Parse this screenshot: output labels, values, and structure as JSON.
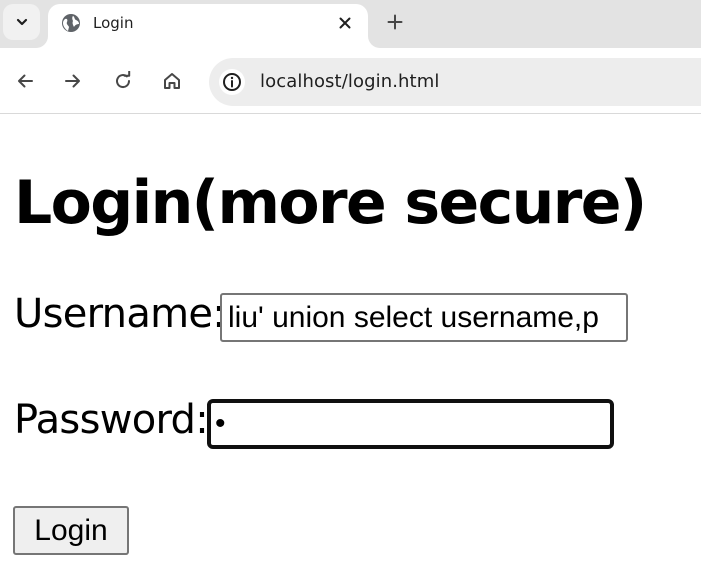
{
  "browser": {
    "tab": {
      "title": "Login",
      "favicon_icon": "globe-icon",
      "close_icon": "close-icon"
    },
    "tab_menu_icon": "chevron-down-icon",
    "new_tab_icon": "plus-icon",
    "nav": {
      "back_icon": "arrow-left-icon",
      "forward_icon": "arrow-right-icon",
      "reload_icon": "reload-icon",
      "home_icon": "home-icon"
    },
    "address_bar": {
      "info_icon": "info-icon",
      "url": "localhost/login.html"
    }
  },
  "page": {
    "title": "Login(more secure)",
    "username": {
      "label": "Username:",
      "value": "liu' union select username,p"
    },
    "password": {
      "label": "Password:",
      "value": "•"
    },
    "login_button": "Login"
  }
}
